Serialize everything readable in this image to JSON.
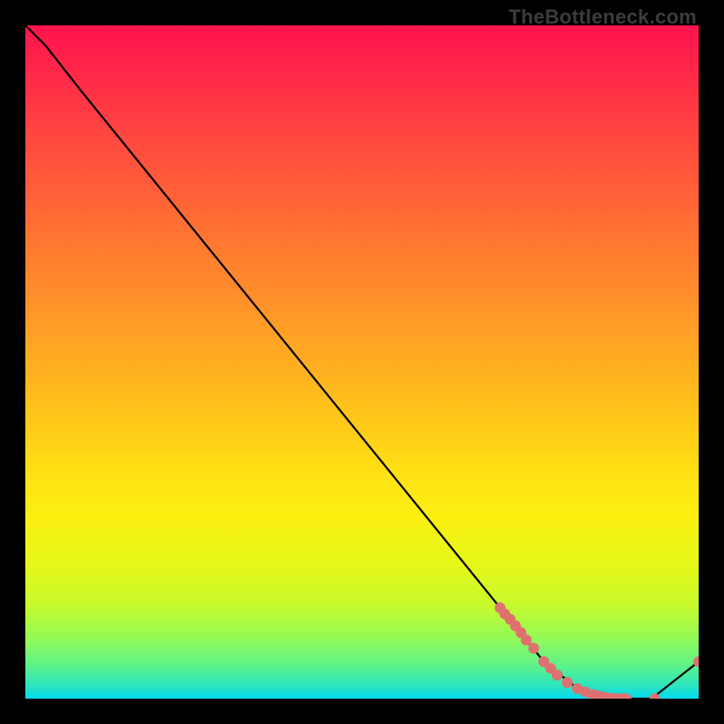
{
  "attribution": "TheBottleneck.com",
  "chart_data": {
    "type": "line",
    "title": "",
    "xlabel": "",
    "ylabel": "",
    "xlim": [
      0,
      1
    ],
    "ylim": [
      0,
      1
    ],
    "series": [
      {
        "name": "curve",
        "x": [
          0.0,
          0.03,
          0.085,
          0.77,
          0.82,
          0.87,
          0.93,
          1.0
        ],
        "y": [
          1.0,
          0.97,
          0.9,
          0.055,
          0.015,
          0.0,
          0.0,
          0.055
        ],
        "stroke": "#000000",
        "stroke_width": 2.2
      },
      {
        "name": "markers",
        "x": [
          0.705,
          0.712,
          0.72,
          0.728,
          0.736,
          0.744,
          0.755,
          0.77,
          0.78,
          0.79,
          0.805,
          0.82,
          0.832,
          0.843,
          0.852,
          0.86,
          0.868,
          0.876,
          0.884,
          0.892,
          0.935,
          1.0
        ],
        "y": [
          0.135,
          0.126,
          0.118,
          0.108,
          0.098,
          0.087,
          0.075,
          0.055,
          0.045,
          0.035,
          0.024,
          0.015,
          0.01,
          0.006,
          0.004,
          0.002,
          0.001,
          0.0,
          0.0,
          0.0,
          0.0,
          0.055
        ],
        "marker_color": "#e07070",
        "marker_radius": 6
      }
    ]
  }
}
